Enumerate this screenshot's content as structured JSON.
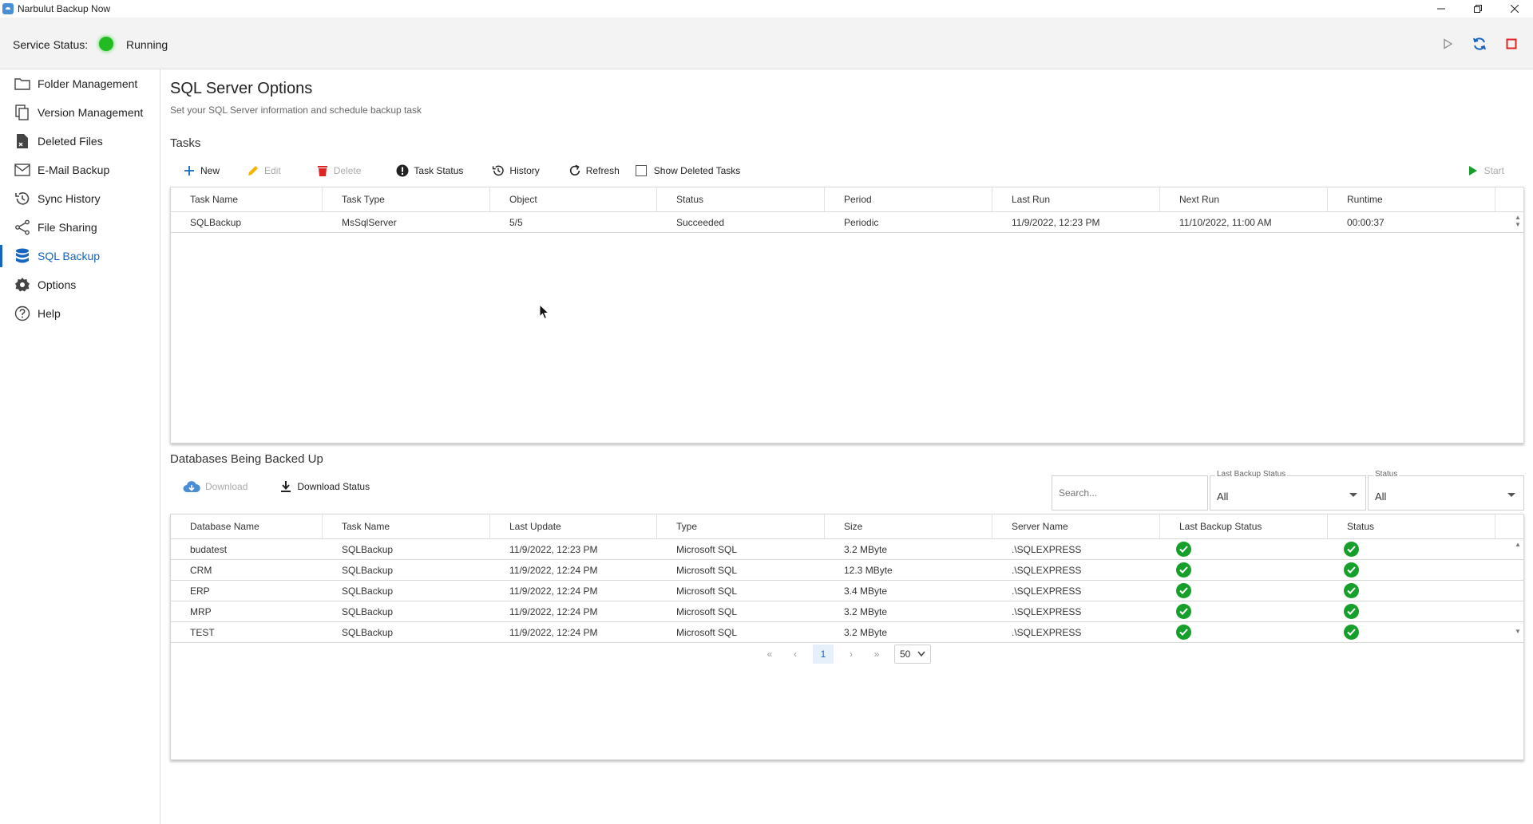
{
  "window": {
    "title": "Narbulut Backup Now"
  },
  "service": {
    "label": "Service Status:",
    "state": "Running",
    "state_color": "#22bb22"
  },
  "sidebar": {
    "items": [
      {
        "label": "Folder Management",
        "icon": "folder-icon"
      },
      {
        "label": "Version Management",
        "icon": "versions-icon"
      },
      {
        "label": "Deleted Files",
        "icon": "deleted-file-icon"
      },
      {
        "label": "E-Mail Backup",
        "icon": "mail-icon"
      },
      {
        "label": "Sync History",
        "icon": "history-icon"
      },
      {
        "label": "File Sharing",
        "icon": "share-icon"
      },
      {
        "label": "SQL Backup",
        "icon": "database-icon",
        "active": true
      },
      {
        "label": "Options",
        "icon": "gear-icon"
      },
      {
        "label": "Help",
        "icon": "help-icon"
      }
    ]
  },
  "page": {
    "title": "SQL Server Options",
    "subtitle": "Set your SQL Server information and schedule backup task"
  },
  "tasks": {
    "title": "Tasks",
    "toolbar": {
      "new": "New",
      "edit": "Edit",
      "delete": "Delete",
      "task_status": "Task Status",
      "history": "History",
      "refresh": "Refresh",
      "show_deleted": "Show Deleted Tasks",
      "start": "Start"
    },
    "columns": [
      "Task Name",
      "Task Type",
      "Object",
      "Status",
      "Period",
      "Last Run",
      "Next Run",
      "Runtime"
    ],
    "rows": [
      [
        "SQLBackup",
        "MsSqlServer",
        "5/5",
        "Succeeded",
        "Periodic",
        "11/9/2022, 12:23 PM",
        "11/10/2022, 11:00 AM",
        "00:00:37"
      ]
    ]
  },
  "databases": {
    "title": "Databases Being Backed Up",
    "toolbar": {
      "download": "Download",
      "download_status": "Download Status"
    },
    "search_placeholder": "Search...",
    "filters": {
      "last_backup_status_label": "Last Backup Status",
      "last_backup_status_value": "All",
      "status_label": "Status",
      "status_value": "All"
    },
    "columns": [
      "Database Name",
      "Task Name",
      "Last Update",
      "Type",
      "Size",
      "Server Name",
      "Last Backup Status",
      "Status"
    ],
    "rows": [
      [
        "budatest",
        "SQLBackup",
        "11/9/2022, 12:23 PM",
        "Microsoft SQL",
        "3.2 MByte",
        ".\\SQLEXPRESS"
      ],
      [
        "CRM",
        "SQLBackup",
        "11/9/2022, 12:24 PM",
        "Microsoft SQL",
        "12.3 MByte",
        ".\\SQLEXPRESS"
      ],
      [
        "ERP",
        "SQLBackup",
        "11/9/2022, 12:24 PM",
        "Microsoft SQL",
        "3.4 MByte",
        ".\\SQLEXPRESS"
      ],
      [
        "MRP",
        "SQLBackup",
        "11/9/2022, 12:24 PM",
        "Microsoft SQL",
        "3.2 MByte",
        ".\\SQLEXPRESS"
      ],
      [
        "TEST",
        "SQLBackup",
        "11/9/2022, 12:24 PM",
        "Microsoft SQL",
        "3.2 MByte",
        ".\\SQLEXPRESS"
      ]
    ],
    "pager": {
      "current_page": "1",
      "page_size": "50"
    }
  },
  "colors": {
    "accent": "#1565c0",
    "success": "#16a02b",
    "danger": "#e02424"
  }
}
